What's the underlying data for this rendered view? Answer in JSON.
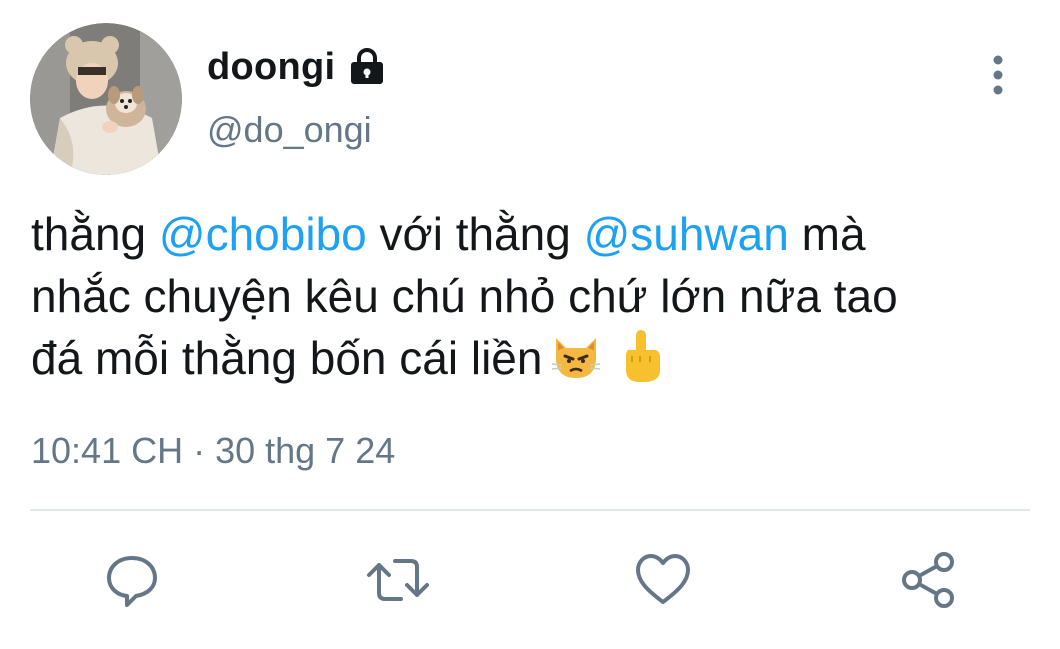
{
  "user": {
    "display_name": "doongi",
    "handle": "@do_ongi",
    "protected": true,
    "avatar_icon": "profile-photo-avatar",
    "lock_icon": "lock-icon"
  },
  "tweet": {
    "lines": [
      {
        "t1": "thằng ",
        "m1": "@chobibo",
        "t2": " với thằng ",
        "m2": "@suhwan",
        "t3": " mà"
      },
      {
        "t1": "nhắc chuyện kêu chú nhỏ chứ lớn nữa tao"
      },
      {
        "t1": "đá mỗi thằng bốn cái liền",
        "emojis": [
          "pouting-cat-emoji",
          "middle-finger-emoji"
        ]
      }
    ],
    "timestamp": "10:41 CH · 30 thg 7 24"
  },
  "actions": {
    "reply_icon": "reply-icon",
    "retweet_icon": "retweet-icon",
    "like_icon": "heart-icon",
    "share_icon": "share-icon",
    "more_icon": "more-vertical-icon"
  },
  "colors": {
    "text": "#14171a",
    "secondary": "#657786",
    "mention": "#1da1f2",
    "divider": "#e1e8ed",
    "icon": "#657786"
  }
}
